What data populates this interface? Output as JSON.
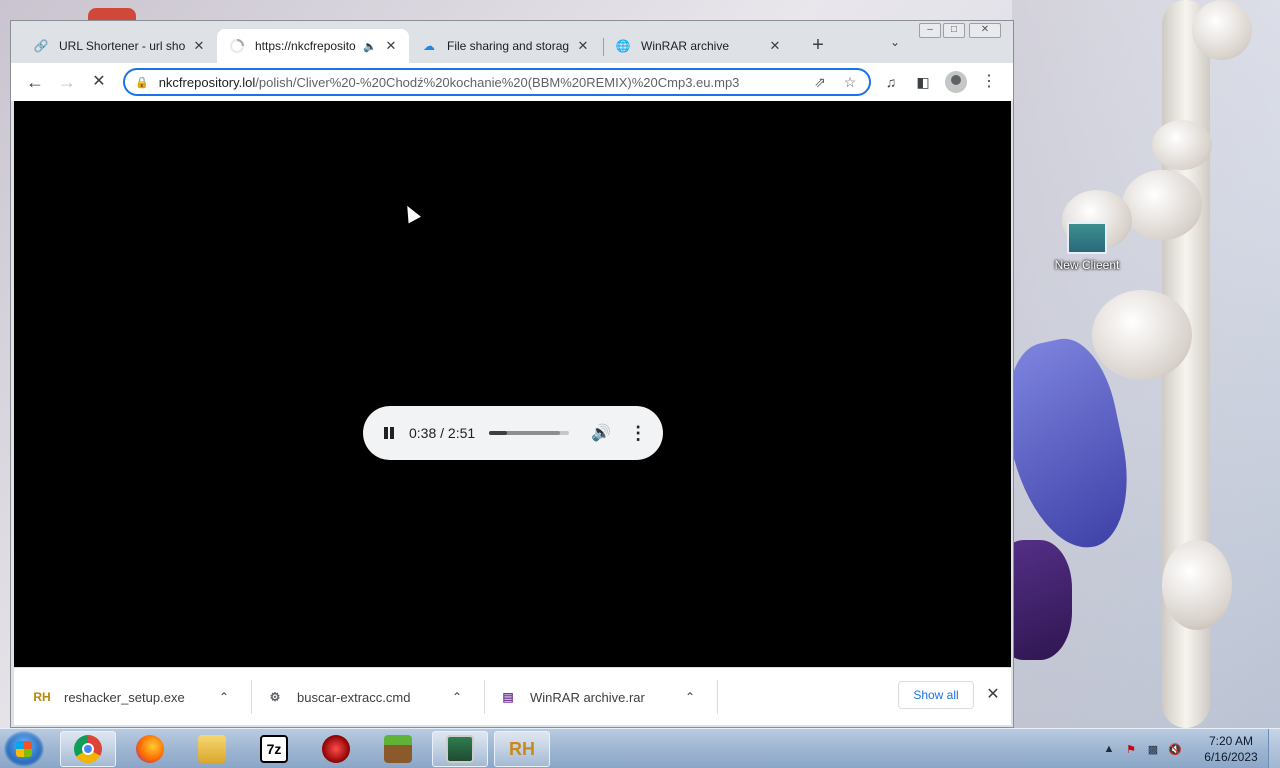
{
  "desktop": {
    "icon_label": "New Clieent"
  },
  "browser": {
    "tabs": [
      {
        "title": "URL Shortener - url shor",
        "icon": "link-icon",
        "active": false
      },
      {
        "title": "https://nkcfreposito",
        "icon": "loading-spinner-icon",
        "active": true,
        "audio": true
      },
      {
        "title": "File sharing and storage",
        "icon": "cloud-icon",
        "active": false
      },
      {
        "title": "WinRAR archive",
        "icon": "globe-icon",
        "active": false
      }
    ],
    "address": {
      "host": "nkcfrepository.lol",
      "path": "/polish/Cliver%20-%20Chodź%20kochanie%20(BBM%20REMIX)%20Cmp3.eu.mp3"
    },
    "player": {
      "current_time": "0:38",
      "duration": "2:51",
      "time_display": "0:38 / 2:51",
      "progress": 0.222,
      "buffered": 0.88
    },
    "downloads": {
      "items": [
        {
          "name": "reshacker_setup.exe",
          "icon": "reshacker-icon"
        },
        {
          "name": "buscar-extracc.cmd",
          "icon": "cmd-file-icon"
        },
        {
          "name": "WinRAR archive.rar",
          "icon": "winrar-icon"
        }
      ],
      "show_all": "Show all"
    }
  },
  "taskbar": {
    "apps": [
      "chrome",
      "firefox",
      "file-explorer",
      "7-zip",
      "unknown-red",
      "minecraft",
      "network-monitor",
      "resource-hacker"
    ],
    "app_labels": {
      "seven_zip": "7z",
      "reshacker": "RH"
    },
    "clock": {
      "time": "7:20 AM",
      "date": "6/16/2023"
    }
  },
  "colors": {
    "accent": "#1a73e8",
    "viewport_bg": "#000000",
    "player_bg": "#f1f3f4"
  }
}
